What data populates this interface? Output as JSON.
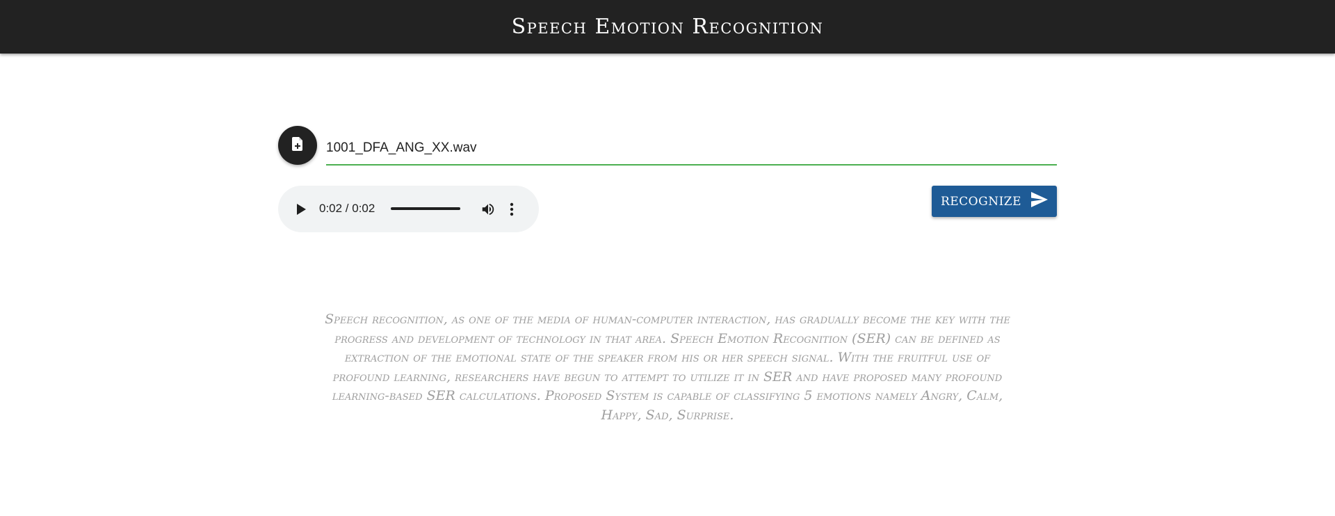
{
  "header": {
    "title": "Speech Emotion Recognition"
  },
  "upload": {
    "icon": "file-add-icon",
    "file_name": "1001_DFA_ANG_XX.wav"
  },
  "audio_player": {
    "time": "0:02 / 0:02",
    "progress_fraction": 1.0,
    "icons": [
      "play-icon",
      "volume-icon",
      "more-vert-icon"
    ]
  },
  "actions": {
    "recognize_label": "RECOGNIZE",
    "recognize_icon": "send-icon",
    "recognize_color": "#1e5b96"
  },
  "description": {
    "text": "Speech recognition, as one of the media of human-computer interaction, has gradually become the key with the progress and development of technology in that area. Speech Emotion Recognition (SER) can be defined as extraction of the emotional state of the speaker from his or her speech signal. With the fruitful use of profound learning, researchers have begun to attempt to utilize it in SER and have proposed many profound learning-based SER calculations. Proposed System is capable of classifying 5 emotions namely Angry, Calm, Happy, Sad, Surprise."
  },
  "colors": {
    "appbar": "#222222",
    "input_underline": "#4caf50",
    "description_text": "#9e9e9e"
  }
}
